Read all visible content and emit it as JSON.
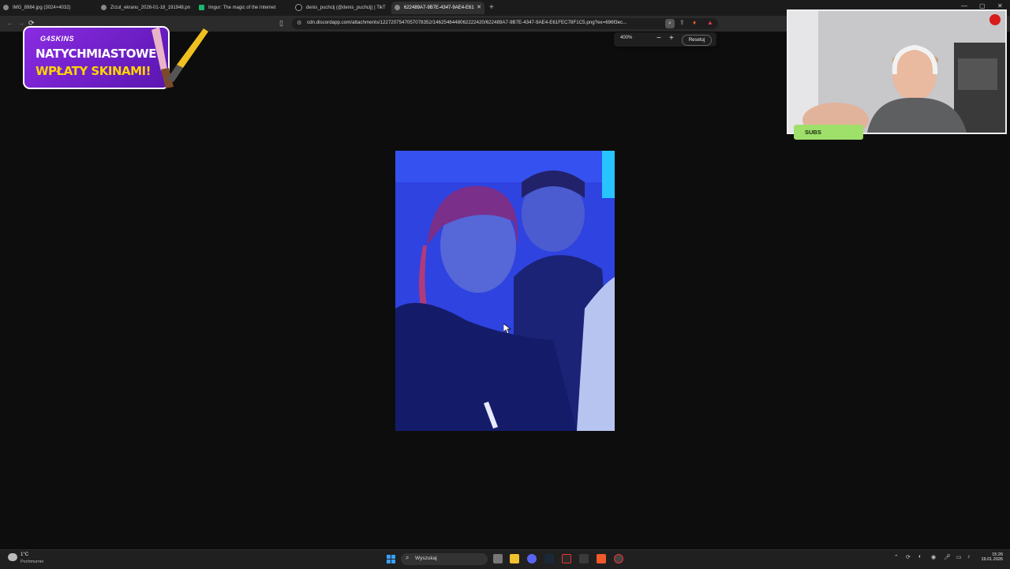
{
  "browser": {
    "tabs": [
      {
        "label": "IMG_8984.jpg (3024×4032)",
        "icon": "globe-icon",
        "active": false
      },
      {
        "label": "Zrzut_ekranu_2026-01-18_191948.pn",
        "icon": "globe-icon",
        "active": false
      },
      {
        "label": "Imgur: The magic of the Internet",
        "icon": "imgur-icon",
        "active": false
      },
      {
        "label": "denis_puchcij (@denis_puchcij) | TikT",
        "icon": "tiktok-icon",
        "active": false
      },
      {
        "label": "622489A7-9B7E-4347-9AE4-E61",
        "icon": "globe-icon",
        "active": true
      }
    ],
    "new_tab": "+",
    "url": "cdn.discordapp.com/attachments/1227207547057078352/1462546448062222420/622489A7-9B7E-4347-9AE4-E61FEC78F1C5.png?ex=696f3ec...",
    "zoom": {
      "level": "400%",
      "minus": "−",
      "plus": "+",
      "reset": "Resetuj"
    }
  },
  "overlay": {
    "brand": "G4SKINS",
    "line1": "NATYCHMIASTOWE",
    "line2": "WPŁATY SKINAMI!",
    "subs_label": "SUBS"
  },
  "taskbar": {
    "weather_temp": "1°C",
    "weather_desc": "Pochmurnie",
    "search_placeholder": "Wyszukaj",
    "time": "15:26",
    "date": "19.01.2026"
  },
  "colors": {
    "banner": "#7b22d6",
    "accent_yellow": "#ffd400",
    "subs_green": "#9ee06a",
    "photo_blue": "#2f43e0"
  }
}
